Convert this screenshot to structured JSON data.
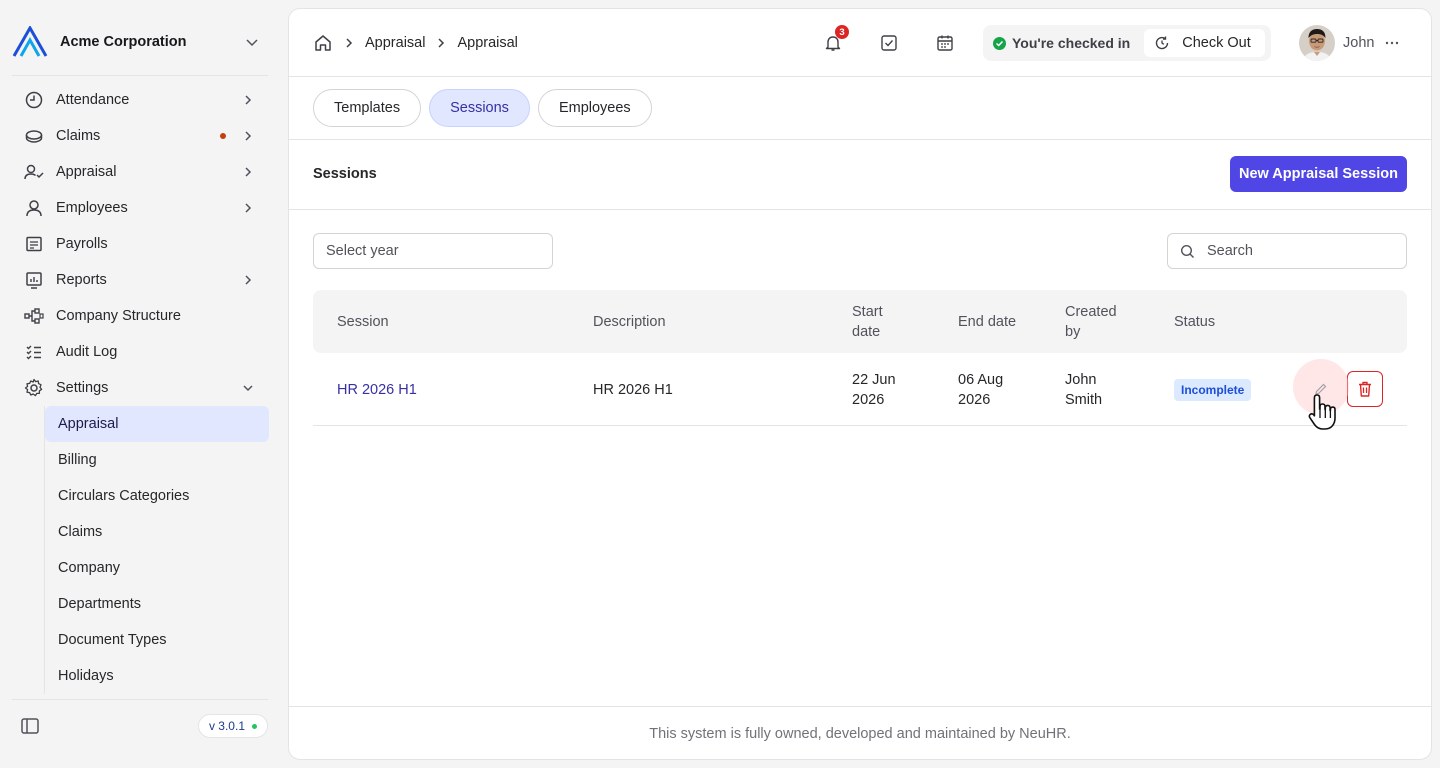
{
  "org": {
    "name": "Acme Corporation"
  },
  "sidebar": {
    "items": [
      {
        "label": "Attendance",
        "icon": "clock-icon",
        "has_chevron": true
      },
      {
        "label": "Claims",
        "icon": "wallet-icon",
        "has_chevron": true,
        "has_dot": true
      },
      {
        "label": "Appraisal",
        "icon": "user-check-icon",
        "has_chevron": true
      },
      {
        "label": "Employees",
        "icon": "user-icon",
        "has_chevron": true
      },
      {
        "label": "Payrolls",
        "icon": "receipt-icon",
        "has_chevron": false
      },
      {
        "label": "Reports",
        "icon": "chart-icon",
        "has_chevron": true
      },
      {
        "label": "Company Structure",
        "icon": "hierarchy-icon",
        "has_chevron": false
      },
      {
        "label": "Audit Log",
        "icon": "list-check-icon",
        "has_chevron": false
      },
      {
        "label": "Settings",
        "icon": "gear-icon",
        "has_chevron": true,
        "expanded": true
      }
    ],
    "settings_children": [
      "Appraisal",
      "Billing",
      "Circulars Categories",
      "Claims",
      "Company",
      "Departments",
      "Document Types",
      "Holidays"
    ],
    "active_child": "Appraisal",
    "version": "v 3.0.1"
  },
  "breadcrumb": [
    "Appraisal",
    "Appraisal"
  ],
  "header": {
    "notification_count": "3",
    "checkin_status": "You're checked in",
    "checkout_label": "Check Out",
    "user_name": "John"
  },
  "tabs": [
    {
      "label": "Templates",
      "active": false
    },
    {
      "label": "Sessions",
      "active": true
    },
    {
      "label": "Employees",
      "active": false
    }
  ],
  "section": {
    "title": "Sessions",
    "new_button": "New Appraisal Session"
  },
  "filters": {
    "year_placeholder": "Select year",
    "search_placeholder": "Search"
  },
  "table": {
    "columns": [
      "Session",
      "Description",
      "Start date",
      "End date",
      "Created by",
      "Status"
    ],
    "rows": [
      {
        "session": "HR 2026 H1",
        "description": "HR 2026 H1",
        "start_date": "22 Jun 2026",
        "end_date": "06 Aug 2026",
        "created_by": "John Smith",
        "status": "Incomplete"
      }
    ]
  },
  "footer": {
    "text": "This system is fully owned, developed and maintained by NeuHR."
  },
  "colors": {
    "primary": "#4f46e5",
    "tab_active_bg": "#e0e7ff",
    "danger": "#dc2626",
    "success": "#16a34a"
  }
}
